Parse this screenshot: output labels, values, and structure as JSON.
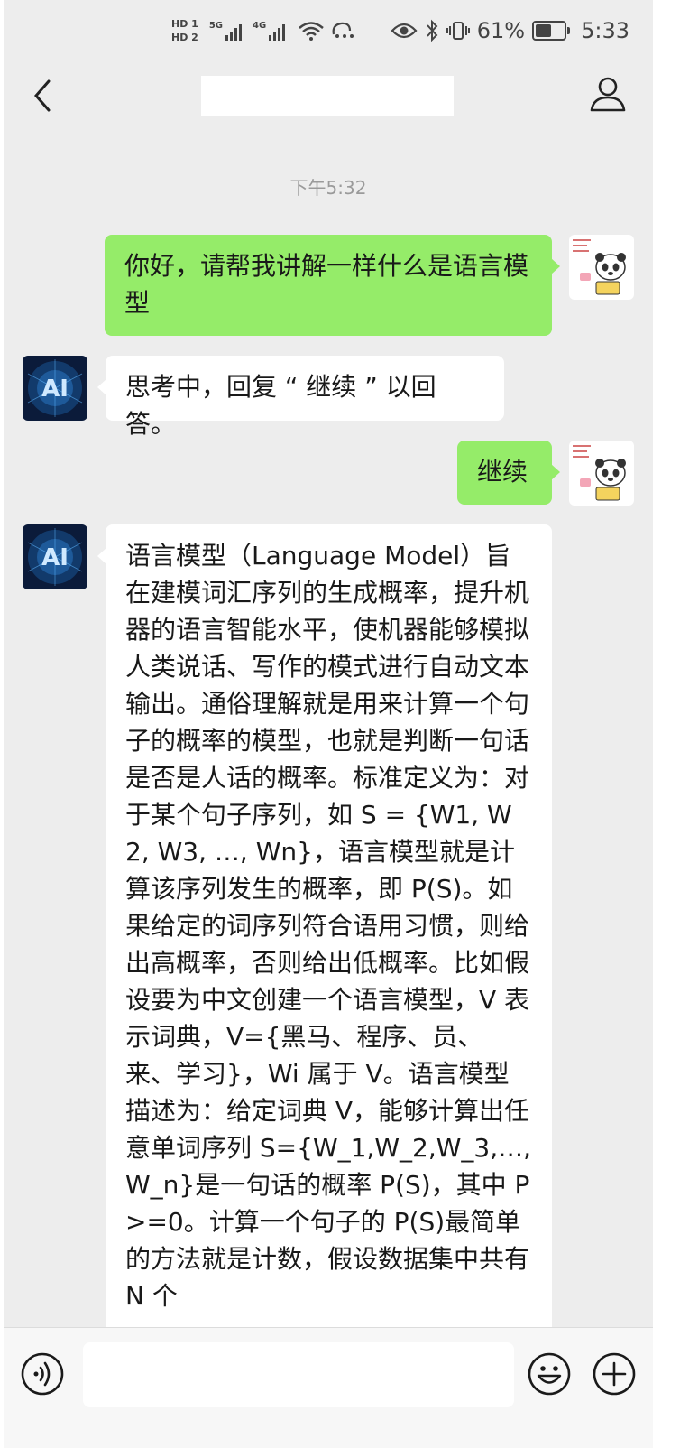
{
  "status_bar": {
    "hd1": "HD 1",
    "hd2": "HD 2",
    "net1": "5G",
    "net2": "4G",
    "battery_percent": "61%",
    "battery_level": 0.61,
    "time": "5:33"
  },
  "header": {
    "back_icon": "chevron-left-icon",
    "profile_icon": "person-icon"
  },
  "chat": {
    "timestamp": "下午5:32",
    "messages": [
      {
        "sender": "me",
        "text": "你好，请帮我讲解一样什么是语言模型"
      },
      {
        "sender": "bot",
        "text": "思考中，回复 “ 继续 ” 以回答。"
      },
      {
        "sender": "me",
        "text": "继续"
      },
      {
        "sender": "bot",
        "text": "语言模型（Language Model）旨在建模词汇序列的生成概率，提升机器的语言智能水平，使机器能够模拟人类说话、写作的模式进行自动文本输出。通俗理解就是用来计算一个句子的概率的模型，也就是判断一句话是否是人话的概率。标准定义为：对于某个句子序列，如 S = {W1, W2, W3, …, Wn}，语言模型就是计算该序列发生的概率，即 P(S)。如果给定的词序列符合语用习惯，则给出高概率，否则给出低概率。比如假设要为中文创建一个语言模型，V 表示词典，V={黑马、程序、员、来、学习}，Wi 属于 V。语言模型描述为：给定词典 V，能够计算出任意单词序列 S={W_1,W_2,W_3,…,W_n}是一句话的概率 P(S)，其中 P>=0。计算一个句子的 P(S)最简单的方法就是计数，假设数据集中共有 N 个"
      }
    ]
  },
  "input_bar": {
    "voice_icon": "voice-icon",
    "emoji_icon": "emoji-icon",
    "plus_icon": "plus-icon",
    "input_value": ""
  },
  "colors": {
    "background": "#ededed",
    "my_bubble": "#95ec69",
    "bot_bubble": "#ffffff"
  }
}
